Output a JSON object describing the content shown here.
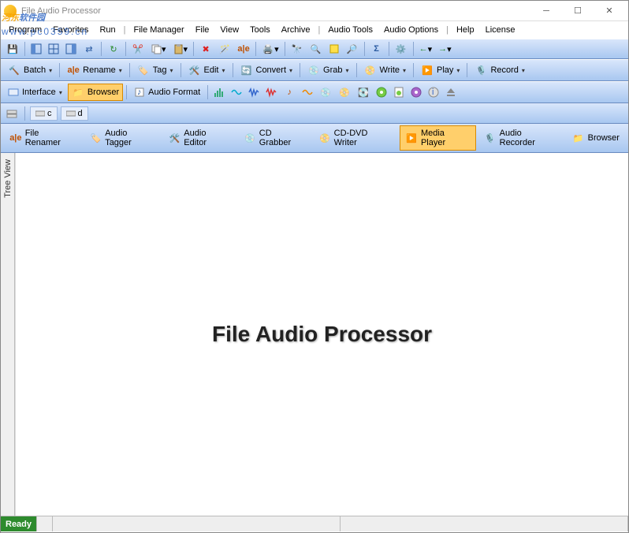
{
  "window": {
    "title": "File Audio Processor"
  },
  "watermark": {
    "cn_a": "河东",
    "cn_b": "软件园",
    "url": "www.pc0359.cn"
  },
  "menubar": [
    "Program",
    "Favorites",
    "Run",
    "File Manager",
    "File",
    "View",
    "Tools",
    "Archive",
    "Audio Tools",
    "Audio Options",
    "Help",
    "License"
  ],
  "menubar_sep_after": [
    2,
    7,
    9
  ],
  "toolbar2": {
    "items": [
      {
        "label": "Batch"
      },
      {
        "label": "Rename"
      },
      {
        "label": "Tag"
      },
      {
        "label": "Edit"
      },
      {
        "label": "Convert"
      },
      {
        "label": "Grab"
      },
      {
        "label": "Write"
      },
      {
        "label": "Play"
      },
      {
        "label": "Record"
      }
    ]
  },
  "toolbar3": {
    "interface": "Interface",
    "browser": "Browser",
    "audio_format": "Audio Format"
  },
  "drives": [
    "c",
    "d"
  ],
  "tabs": [
    {
      "label": "File Renamer"
    },
    {
      "label": "Audio Tagger"
    },
    {
      "label": "Audio Editor"
    },
    {
      "label": "CD Grabber"
    },
    {
      "label": "CD-DVD Writer"
    },
    {
      "label": "Media Player",
      "active": true
    },
    {
      "label": "Audio Recorder"
    },
    {
      "label": "Browser"
    }
  ],
  "tree_label": "Tree View",
  "main_text": "File Audio Processor",
  "status": {
    "ready": "Ready"
  },
  "colors": {
    "toolbar_top": "#d9e6fb",
    "toolbar_bot": "#a8c7f0",
    "active": "#ffcf6b"
  }
}
